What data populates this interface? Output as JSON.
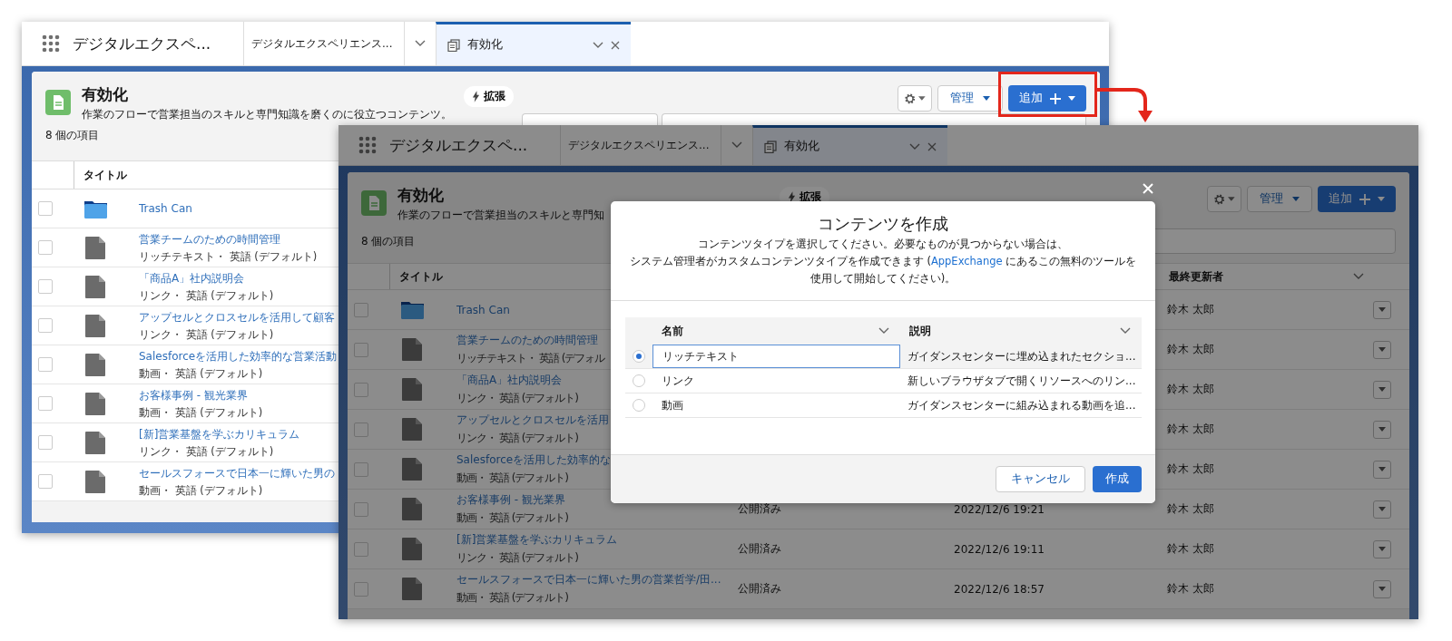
{
  "windows": [
    {
      "kind": "main",
      "app_title": "デジタルエクスペ...",
      "tabs": [
        {
          "label": "デジタルエクスペリエンス...",
          "selected": false
        },
        {
          "label": "有効化",
          "selected": true
        }
      ],
      "header": {
        "title": "有効化",
        "description": "作業のフローで営業担当のスキルと専門知識を磨くのに役立つコンテンツ。",
        "boost_button": "拡張",
        "manage_button": "管理",
        "add_button": "追加",
        "item_count": "8 個の項目"
      },
      "columns": [
        {
          "kind": "title",
          "label": "タイトル"
        }
      ],
      "rows": [
        {
          "kind": "folder",
          "checked": false,
          "title": "Trash Can"
        },
        {
          "kind": "file",
          "checked": false,
          "title": "営業チームのための時間管理",
          "subtitle": "リッチテキスト・ 英語 (デフォルト)"
        },
        {
          "kind": "file",
          "checked": false,
          "title": "「商品A」社内説明会",
          "subtitle": "リンク・ 英語 (デフォルト)"
        },
        {
          "kind": "file",
          "checked": false,
          "title": "アップセルとクロスセルを活用して顧客",
          "subtitle": "リンク・ 英語 (デフォルト)"
        },
        {
          "kind": "file",
          "checked": false,
          "title": "Salesforceを活用した効率的な営業活動",
          "subtitle": "動画・ 英語 (デフォルト)"
        },
        {
          "kind": "file",
          "checked": false,
          "title": "お客様事例 - 観光業界",
          "subtitle": "動画・ 英語 (デフォルト)"
        },
        {
          "kind": "file",
          "checked": false,
          "title": "[新]営業基盤を学ぶカリキュラム",
          "subtitle": "リンク・ 英語 (デフォルト)"
        },
        {
          "kind": "file",
          "checked": false,
          "title": "セールスフォースで日本一に輝いた男の",
          "subtitle": "動画・ 英語 (デフォルト)"
        }
      ]
    },
    {
      "kind": "overlay",
      "app_title": "デジタルエクスペ...",
      "tabs": [
        {
          "label": "デジタルエクスペリエンス...",
          "selected": false
        },
        {
          "label": "有効化",
          "selected": true
        }
      ],
      "header": {
        "title": "有効化",
        "description": "作業のフローで営業担当のスキルと専門知",
        "boost_button": "拡張",
        "manage_button": "管理",
        "add_button": "追加",
        "item_count": "8 個の項目"
      },
      "columns": [
        {
          "kind": "title",
          "label": "タイトル"
        },
        {
          "kind": "owner",
          "label": "最終更新者"
        }
      ],
      "rows": [
        {
          "kind": "folder",
          "checked": false,
          "title": "Trash Can",
          "owner": "鈴木 太郎"
        },
        {
          "kind": "file",
          "checked": false,
          "title": "営業チームのための時間管理",
          "subtitle": "リッチテキスト・ 英語 (デフォル",
          "owner": "鈴木 太郎"
        },
        {
          "kind": "file",
          "checked": false,
          "title": "「商品A」社内説明会",
          "subtitle": "リンク・ 英語 (デフォルト)",
          "owner": "鈴木 太郎"
        },
        {
          "kind": "file",
          "checked": false,
          "title": "アップセルとクロスセルを活用",
          "subtitle": "リンク・ 英語 (デフォルト)",
          "owner": "鈴木 太郎"
        },
        {
          "kind": "file",
          "checked": false,
          "title": "Salesforceを活用した効率的な",
          "subtitle": "動画・ 英語 (デフォルト)",
          "owner": "鈴木 太郎"
        },
        {
          "kind": "file",
          "checked": false,
          "title": "お客様事例 - 観光業界",
          "subtitle": "動画・ 英語 (デフォルト)",
          "status": "公開済み",
          "date": "2022/12/6 19:21",
          "owner": "鈴木 太郎"
        },
        {
          "kind": "file",
          "checked": false,
          "title": "[新]営業基盤を学ぶカリキュラム",
          "subtitle": "リンク・ 英語 (デフォルト)",
          "status": "公開済み",
          "date": "2022/12/6 19:11",
          "owner": "鈴木 太郎"
        },
        {
          "kind": "file",
          "checked": false,
          "title": "セールスフォースで日本一に輝いた男の営業哲学/田...",
          "subtitle": "動画・ 英語 (デフォルト)",
          "status": "公開済み",
          "date": "2022/12/6 18:57",
          "owner": "鈴木 太郎"
        }
      ]
    }
  ],
  "modal": {
    "title": "コンテンツを作成",
    "description": {
      "before": [
        "コンテンツタイプを選択してください。必要なものが見つからない場合は、",
        "システム管理者がカスタムコンテンツタイプを作成できます ("
      ],
      "link": "AppExchange",
      "after": [
        " にあるこの無料のツールを",
        "使用して開始してください)。"
      ]
    },
    "columns": [
      "名前",
      "説明"
    ],
    "rows": [
      {
        "name": "リッチテキスト",
        "description": "ガイダンスセンターに埋め込まれたセクショ...",
        "selected": true
      },
      {
        "name": "リンク",
        "description": "新しいブラウザタブで開くリソースへのリン...",
        "selected": false
      },
      {
        "name": "動画",
        "description": "ガイダンスセンターに組み込まれる動画を追...",
        "selected": false
      }
    ],
    "cancel_button": "キャンセル",
    "create_button": "作成"
  }
}
